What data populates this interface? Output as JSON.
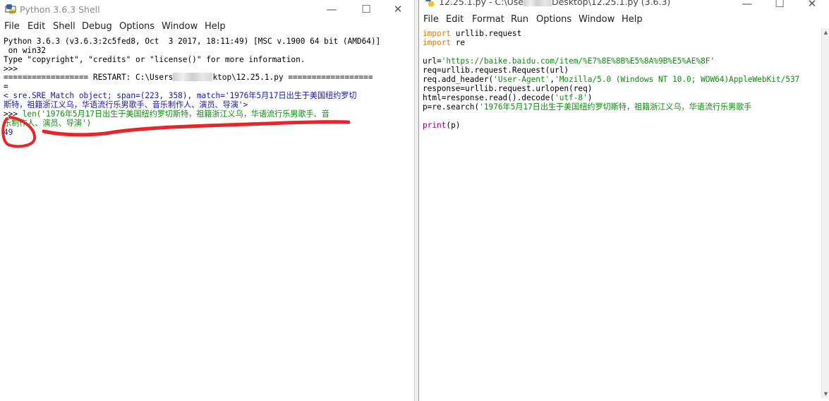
{
  "shell": {
    "title": "Python 3.6.3 Shell",
    "menu": [
      "File",
      "Edit",
      "Shell",
      "Debug",
      "Options",
      "Window",
      "Help"
    ],
    "lines": {
      "l1": "Python 3.6.3 (v3.6.3:2c5fed8, Oct  3 2017, 18:11:49) [MSC v.1900 64 bit (AMD64)]",
      "l2": " on win32",
      "l3": "Type \"copyright\", \"credits\" or \"license()\" for more information.",
      "l4": ">>> ",
      "l5a": "================== RESTART: C:\\Users",
      "l5b": "ktop\\12.25.1.py ==================",
      "l6": "=",
      "l7": "<_sre.SRE_Match object; span=(223, 358), match='1976年5月17日出生于美国纽约罗切",
      "l8": "斯特，祖籍浙江义乌，华语流行乐男歌手、音乐制作人、演员、导演'>",
      "l9_prompt": ">>> ",
      "l9_code": "len('1976年5月17日出生于美国纽约罗切斯特，祖籍浙江义乌，华语流行乐男歌手、音",
      "l10": "乐制作人、演员、导演')",
      "l11": "49"
    }
  },
  "editor": {
    "title_a": "12.25.1.py - C:\\Use",
    "title_b": "Desktop\\12.25.1.py (3.6.3)",
    "menu": [
      "File",
      "Edit",
      "Format",
      "Run",
      "Options",
      "Window",
      "Help"
    ],
    "code": {
      "c1_kw": "import",
      "c1_rest": " urllib.request",
      "c2_kw": "import",
      "c2_rest": " re",
      "c4_a": "url=",
      "c4_str": "'https://baike.baidu.com/item/%E7%8E%8B%E5%8A%9B%E5%AE%8F'",
      "c5": "req=urllib.request.Request(url)",
      "c6_a": "req.add_header(",
      "c6_s1": "'User-Agent'",
      "c6_b": ",",
      "c6_s2": "'Mozilla/5.0 (Windows NT 10.0; WOW64)AppleWebKit/537",
      "c7": "response=urllib.request.urlopen(req)",
      "c8_a": "html=response.read().decode(",
      "c8_s": "'utf-8'",
      "c8_b": ")",
      "c9_a": "p=re.search(",
      "c9_s": "'1976年5月17日出生于美国纽约罗切斯特，祖籍浙江义乌，华语流行乐男歌手",
      "c11_kw": "print",
      "c11_rest": "(p)"
    }
  },
  "colors": {
    "keyword": "#e07800",
    "string": "#0a8f0a",
    "output": "#1515c0",
    "annotation": "#e8262a"
  }
}
